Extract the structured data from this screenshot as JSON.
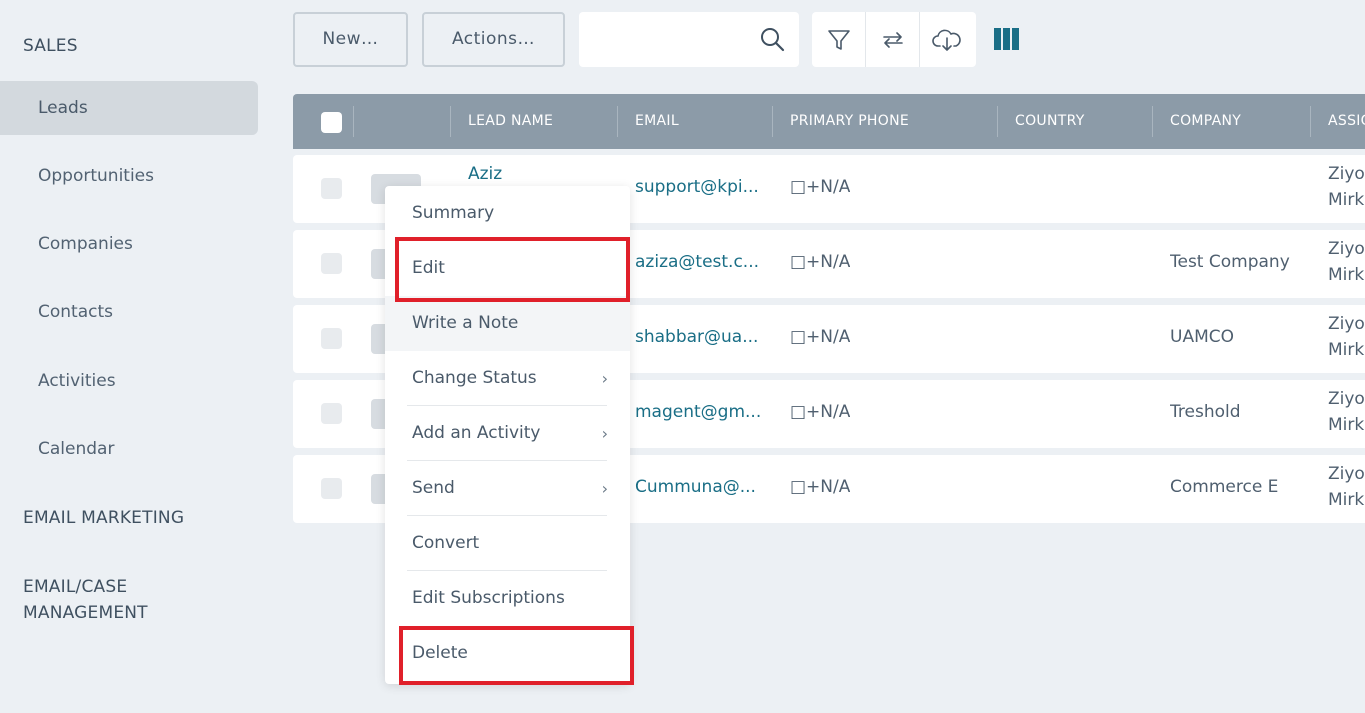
{
  "sidebar": {
    "sales_label": "SALES",
    "items": [
      {
        "label": "Leads",
        "active": true
      },
      {
        "label": "Opportunities"
      },
      {
        "label": "Companies"
      },
      {
        "label": "Contacts"
      },
      {
        "label": "Activities"
      },
      {
        "label": "Calendar"
      }
    ],
    "email_marketing_label": "EMAIL MARKETING",
    "email_case_line1": "EMAIL/CASE",
    "email_case_line2": "MANAGEMENT"
  },
  "toolbar": {
    "new_label": "New…",
    "actions_label": "Actions…",
    "search_value": "",
    "icons": [
      "search-icon",
      "filter-icon",
      "refresh-icon",
      "download-icon",
      "columns-icon"
    ]
  },
  "table": {
    "columns": [
      "LEAD NAME",
      "EMAIL",
      "PRIMARY PHONE",
      "COUNTRY",
      "COMPANY",
      "ASSIG"
    ],
    "rows": [
      {
        "name": "Aziz",
        "email": "support@kpi...",
        "phone": "□+N/A",
        "country": "",
        "company": "",
        "assigned1": "Ziyo",
        "assigned2": "Mirk"
      },
      {
        "name": "",
        "email": "aziza@test.c...",
        "phone": "□+N/A",
        "country": "",
        "company": "Test Company",
        "assigned1": "Ziyo",
        "assigned2": "Mirk"
      },
      {
        "name": "",
        "email": "shabbar@ua...",
        "phone": "□+N/A",
        "country": "",
        "company": "UAMCO",
        "assigned1": "Ziyo",
        "assigned2": "Mirk"
      },
      {
        "name": "",
        "email": "magent@gm...",
        "phone": "□+N/A",
        "country": "",
        "company": "Treshold",
        "assigned1": "Ziyo",
        "assigned2": "Mirk"
      },
      {
        "name": "",
        "email": "Cummuna@...",
        "phone": "□+N/A",
        "country": "",
        "company": "Commerce E",
        "assigned1": "Ziyo",
        "assigned2": "Mirk"
      }
    ]
  },
  "context_menu": {
    "items": [
      {
        "label": "Summary"
      },
      {
        "label": "Edit",
        "highlighted": true
      },
      {
        "label": "Write a Note",
        "hovered": true
      },
      {
        "label": "Change Status",
        "submenu": true
      },
      {
        "label": "Add an Activity",
        "submenu": true
      },
      {
        "label": "Send",
        "submenu": true
      },
      {
        "label": "Convert"
      },
      {
        "label": "Edit Subscriptions"
      },
      {
        "label": "Delete",
        "highlighted": true
      }
    ],
    "submenu_glyph": "›"
  },
  "colors": {
    "highlight": "#e0202a",
    "header_bg": "#8c9ba8",
    "link": "#1a6e86",
    "columns_icon": "#1a6e86"
  }
}
